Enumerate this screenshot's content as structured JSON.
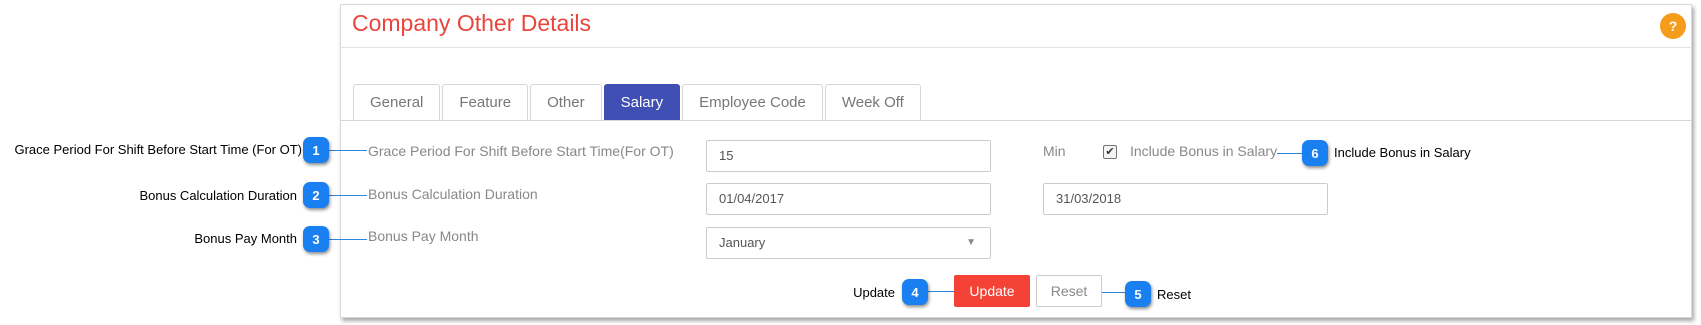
{
  "panel": {
    "title": "Company Other Details",
    "help_icon": "?"
  },
  "tabs": [
    {
      "label": "General",
      "active": false
    },
    {
      "label": "Feature",
      "active": false
    },
    {
      "label": "Other",
      "active": false
    },
    {
      "label": "Salary",
      "active": true
    },
    {
      "label": "Employee Code",
      "active": false
    },
    {
      "label": "Week Off",
      "active": false
    }
  ],
  "form": {
    "grace_label": "Grace Period For Shift Before Start Time(For OT)",
    "grace_value": "15",
    "min_label": "Min",
    "include_bonus_checked": true,
    "include_bonus_label": "Include Bonus in Salary",
    "bonus_duration_label": "Bonus Calculation Duration",
    "bonus_from": "01/04/2017",
    "bonus_to": "31/03/2018",
    "bonus_month_label": "Bonus Pay Month",
    "bonus_month_value": "January",
    "update_label": "Update",
    "reset_label": "Reset"
  },
  "callouts": [
    {
      "num": "1",
      "text": "Grace Period For Shift Before Start Time (For OT)"
    },
    {
      "num": "2",
      "text": "Bonus Calculation Duration"
    },
    {
      "num": "3",
      "text": "Bonus Pay Month"
    },
    {
      "num": "4",
      "text": "Update"
    },
    {
      "num": "5",
      "text": "Reset"
    },
    {
      "num": "6",
      "text": "Include Bonus in Salary"
    }
  ],
  "colors": {
    "title": "#e9453c",
    "active_tab": "#3f4fb3",
    "update_button": "#f44336",
    "badge": "#1a7ff0",
    "help": "#f59c1a"
  }
}
